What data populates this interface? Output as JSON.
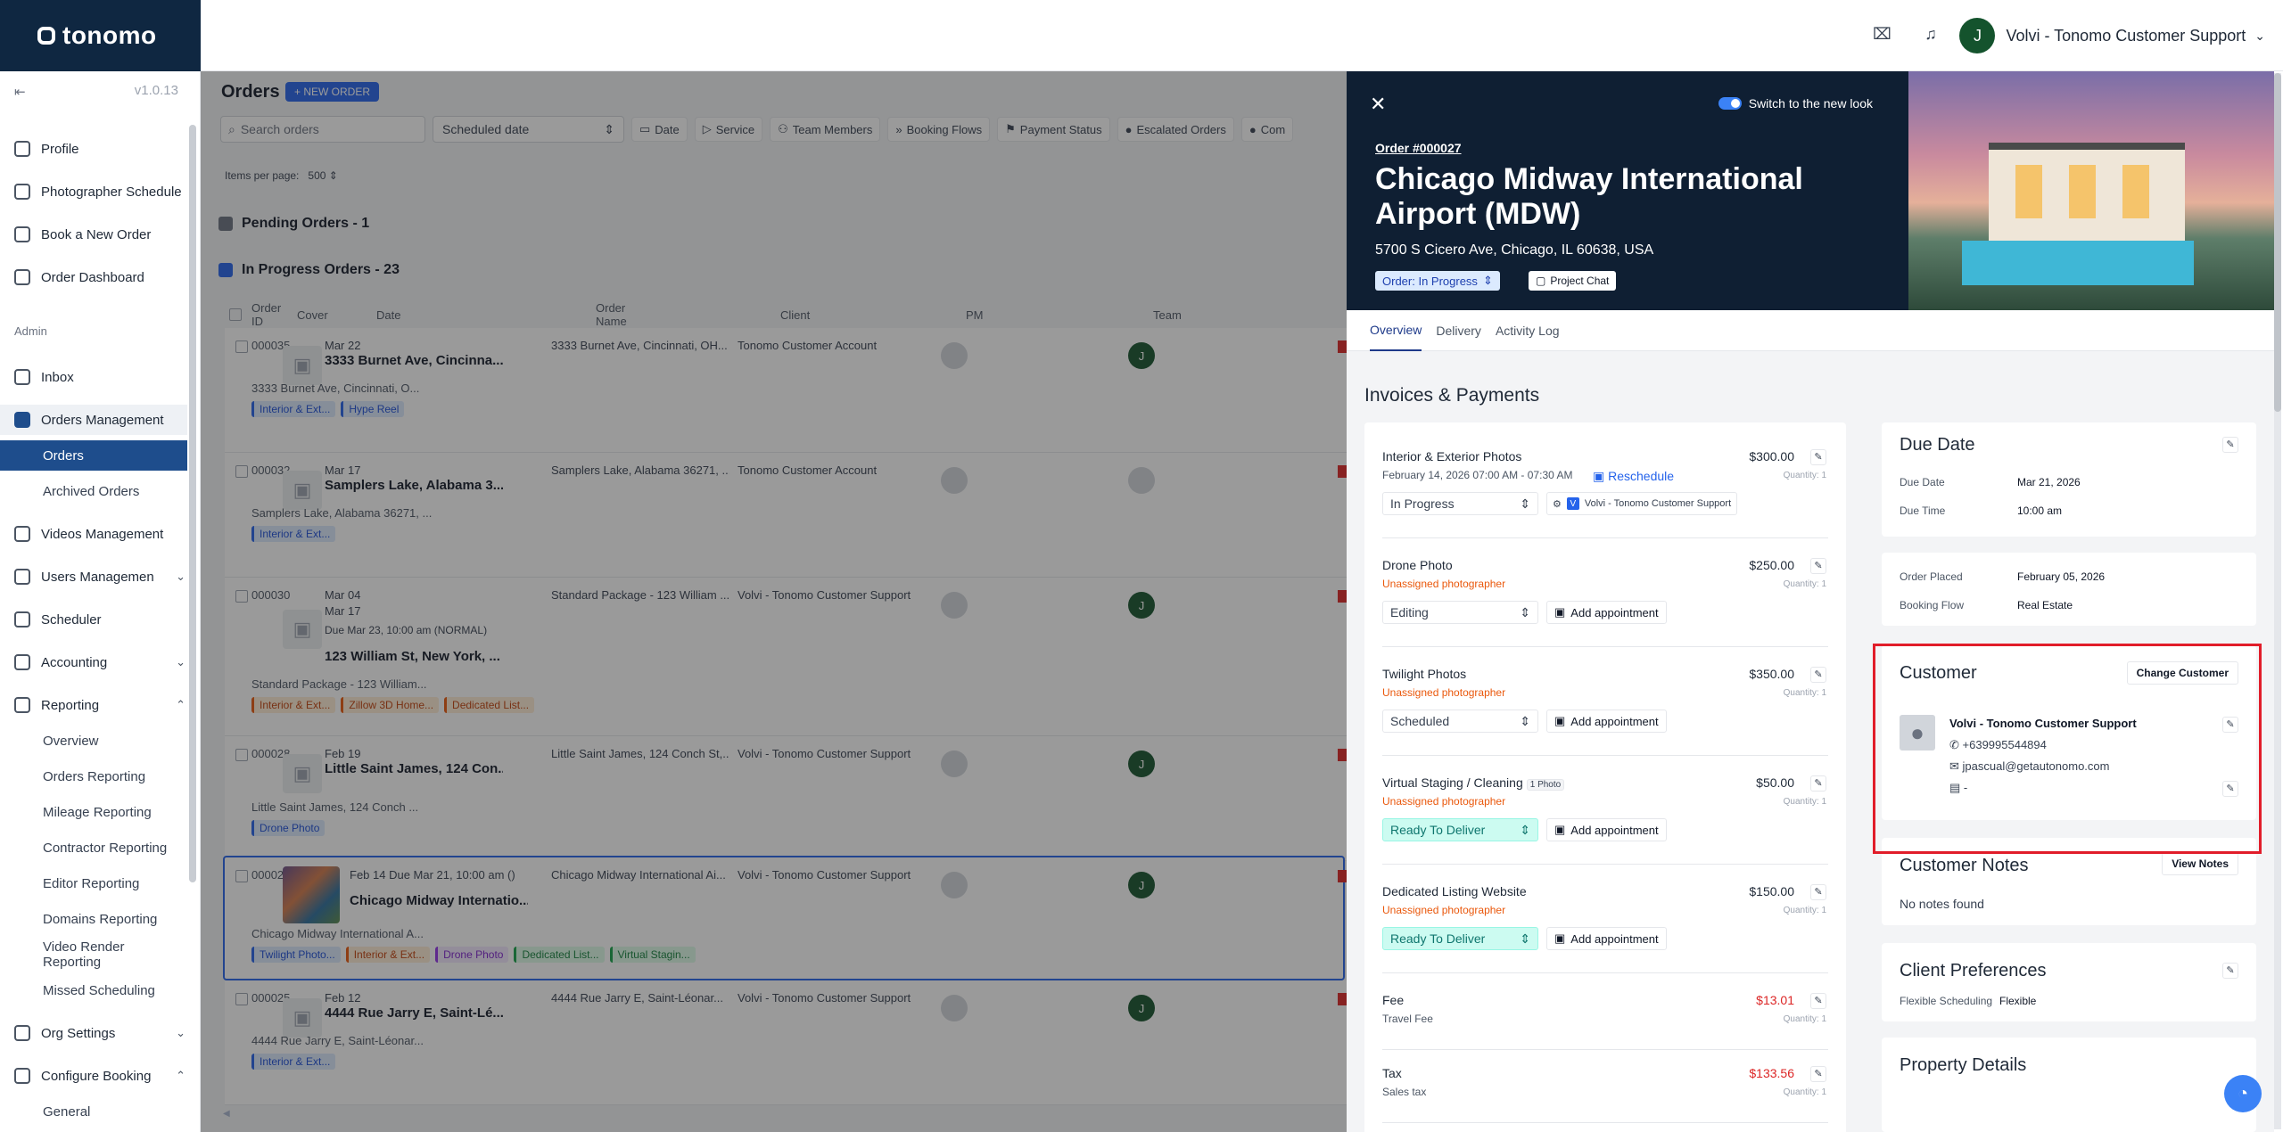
{
  "app": {
    "logo": "tonomo",
    "version": "v1.0.13"
  },
  "topbar": {
    "user_initial": "J",
    "user_name": "Volvi - Tonomo Customer Support",
    "chevron": "⌄"
  },
  "sidebar": {
    "items": [
      {
        "label": "Profile"
      },
      {
        "label": "Photographer Schedule"
      },
      {
        "label": "Book a New Order"
      },
      {
        "label": "Order Dashboard"
      }
    ],
    "section_admin": "Admin",
    "admin_items": [
      {
        "label": "Inbox"
      },
      {
        "label": "Orders Management"
      },
      {
        "label": "Videos Management"
      },
      {
        "label": "Users Managemen"
      },
      {
        "label": "Scheduler"
      },
      {
        "label": "Accounting"
      },
      {
        "label": "Reporting"
      },
      {
        "label": "Org Settings"
      },
      {
        "label": "Configure Booking"
      }
    ],
    "orders_sub": [
      "Orders",
      "Archived Orders"
    ],
    "reporting_sub": [
      "Overview",
      "Orders Reporting",
      "Mileage Reporting",
      "Contractor Reporting",
      "Editor Reporting",
      "Domains Reporting",
      "Video Render Reporting",
      "Missed Scheduling"
    ],
    "booking_sub": [
      "General"
    ]
  },
  "orders": {
    "title": "Orders",
    "new_order": "+ NEW ORDER",
    "search_placeholder": "Search orders",
    "sched_select": "Scheduled date",
    "filters": [
      "Date",
      "Service",
      "Team Members",
      "Booking Flows",
      "Payment Status",
      "Escalated Orders",
      "Com"
    ],
    "items_per_page_label": "Items per page:",
    "items_per_page": "500",
    "group_pending": "Pending Orders - 1",
    "group_inprogress": "In Progress Orders - 23",
    "columns": [
      "Order ID",
      "Cover",
      "Date",
      "Order Name",
      "Client",
      "PM",
      "Team"
    ],
    "rows": [
      {
        "id": "000035",
        "date": "Mar 22",
        "name": "3333 Burnet Ave, Cincinna...",
        "oname": "3333 Burnet Ave, Cincinnati, OH...",
        "client": "Tonomo Customer Account",
        "team": "J",
        "addr": "3333 Burnet Ave, Cincinnati, O...",
        "tags": [
          {
            "t": "Interior & Ext...",
            "c": "blue"
          },
          {
            "t": "Hype Reel",
            "c": "blue"
          }
        ]
      },
      {
        "id": "000032",
        "date": "Mar 17",
        "name": "Samplers Lake, Alabama 3...",
        "oname": "Samplers Lake, Alabama 36271, ...",
        "client": "Tonomo Customer Account",
        "team": "",
        "addr": "Samplers Lake, Alabama 36271, ...",
        "tags": [
          {
            "t": "Interior & Ext...",
            "c": "blue"
          }
        ]
      },
      {
        "id": "000030",
        "date": "Mar 04",
        "date2": "Mar 17",
        "due": "Due Mar 23, 10:00 am (NORMAL)",
        "name": "123 William St, New York, ...",
        "oname": "Standard Package - 123 William ...",
        "client": "Volvi - Tonomo Customer Support",
        "team": "J",
        "addr": "Standard Package - 123 William...",
        "tags": [
          {
            "t": "Interior & Ext...",
            "c": "orange"
          },
          {
            "t": "Zillow 3D Home...",
            "c": "orange"
          },
          {
            "t": "Dedicated List...",
            "c": "orange"
          }
        ]
      },
      {
        "id": "000028",
        "date": "Feb 19",
        "name": "Little Saint James, 124 Con...",
        "oname": "Little Saint James, 124 Conch St,...",
        "client": "Volvi - Tonomo Customer Support",
        "team": "J",
        "addr": "Little Saint James, 124 Conch ...",
        "tags": [
          {
            "t": "Drone Photo",
            "c": "blue"
          }
        ]
      },
      {
        "id": "000027",
        "date": "Feb 14 Due Mar 21, 10:00 am ()",
        "name": "Chicago Midway Internatio...",
        "oname": "Chicago Midway International Ai...",
        "client": "Volvi - Tonomo Customer Support",
        "team": "J",
        "addr": "Chicago Midway International A...",
        "tags": [
          {
            "t": "Twilight Photo...",
            "c": "blue"
          },
          {
            "t": "Interior & Ext...",
            "c": "orange"
          },
          {
            "t": "Drone Photo",
            "c": "purple"
          },
          {
            "t": "Dedicated List...",
            "c": "green"
          },
          {
            "t": "Virtual Stagin...",
            "c": "green"
          }
        ]
      },
      {
        "id": "000025",
        "date": "Feb 12",
        "name": "4444 Rue Jarry E, Saint-Lé...",
        "oname": "4444 Rue Jarry E, Saint-Léonar...",
        "client": "Volvi - Tonomo Customer Support",
        "team": "J",
        "addr": "4444 Rue Jarry E, Saint-Léonar...",
        "tags": [
          {
            "t": "Interior & Ext...",
            "c": "blue"
          }
        ]
      }
    ],
    "team_caption": "Volvi"
  },
  "panel": {
    "toggle_label": "Switch to the new look",
    "order_no": "Order #000027",
    "title": "Chicago Midway International Airport (MDW)",
    "address": "5700 S Cicero Ave, Chicago, IL 60638, USA",
    "status": "Order: In Progress",
    "chat": "Project Chat",
    "tabs": [
      "Overview",
      "Delivery",
      "Activity Log"
    ],
    "invoices_title": "Invoices & Payments",
    "line_items": [
      {
        "name": "Interior & Exterior Photos",
        "price": "$300.00",
        "qty": "Quantity: 1",
        "sub": "February 14, 2026 07:00 AM - 07:30 AM",
        "reschedule": "Reschedule",
        "status": "In Progress",
        "assignee": "Volvi - Tonomo Customer Support"
      },
      {
        "name": "Drone Photo",
        "price": "$250.00",
        "qty": "Quantity: 1",
        "sub": "Unassigned photographer",
        "status": "Editing",
        "action": "Add appointment"
      },
      {
        "name": "Twilight Photos",
        "price": "$350.00",
        "qty": "Quantity: 1",
        "sub": "Unassigned photographer",
        "status": "Scheduled",
        "action": "Add appointment"
      },
      {
        "name": "Virtual Staging / Cleaning",
        "badge": "1 Photo",
        "price": "$50.00",
        "qty": "Quantity: 1",
        "sub": "Unassigned photographer",
        "status": "Ready To Deliver",
        "action": "Add appointment"
      },
      {
        "name": "Dedicated Listing Website",
        "price": "$150.00",
        "qty": "Quantity: 1",
        "sub": "Unassigned photographer",
        "status": "Ready To Deliver",
        "action": "Add appointment"
      },
      {
        "name": "Fee",
        "price": "$13.01",
        "qty": "Quantity: 1",
        "sub": "Travel Fee"
      },
      {
        "name": "Tax",
        "price": "$133.56",
        "qty": "Quantity: 1",
        "sub": "Sales tax"
      }
    ],
    "due": {
      "title": "Due Date",
      "due_date_label": "Due Date",
      "due_date": "Mar 21, 2026",
      "due_time_label": "Due Time",
      "due_time": "10:00 am"
    },
    "placed": {
      "order_placed_label": "Order Placed",
      "order_placed": "February 05, 2026",
      "booking_flow_label": "Booking Flow",
      "booking_flow": "Real Estate"
    },
    "customer": {
      "title": "Customer",
      "change": "Change Customer",
      "name": "Volvi - Tonomo Customer Support",
      "phone": "+639995544894",
      "email": "jpascual@getautonomo.com",
      "extra": "-"
    },
    "notes": {
      "title": "Customer Notes",
      "view": "View Notes",
      "empty": "No notes found"
    },
    "prefs": {
      "title": "Client Preferences",
      "label": "Flexible Scheduling",
      "value": "Flexible"
    },
    "property": {
      "title": "Property Details"
    }
  }
}
